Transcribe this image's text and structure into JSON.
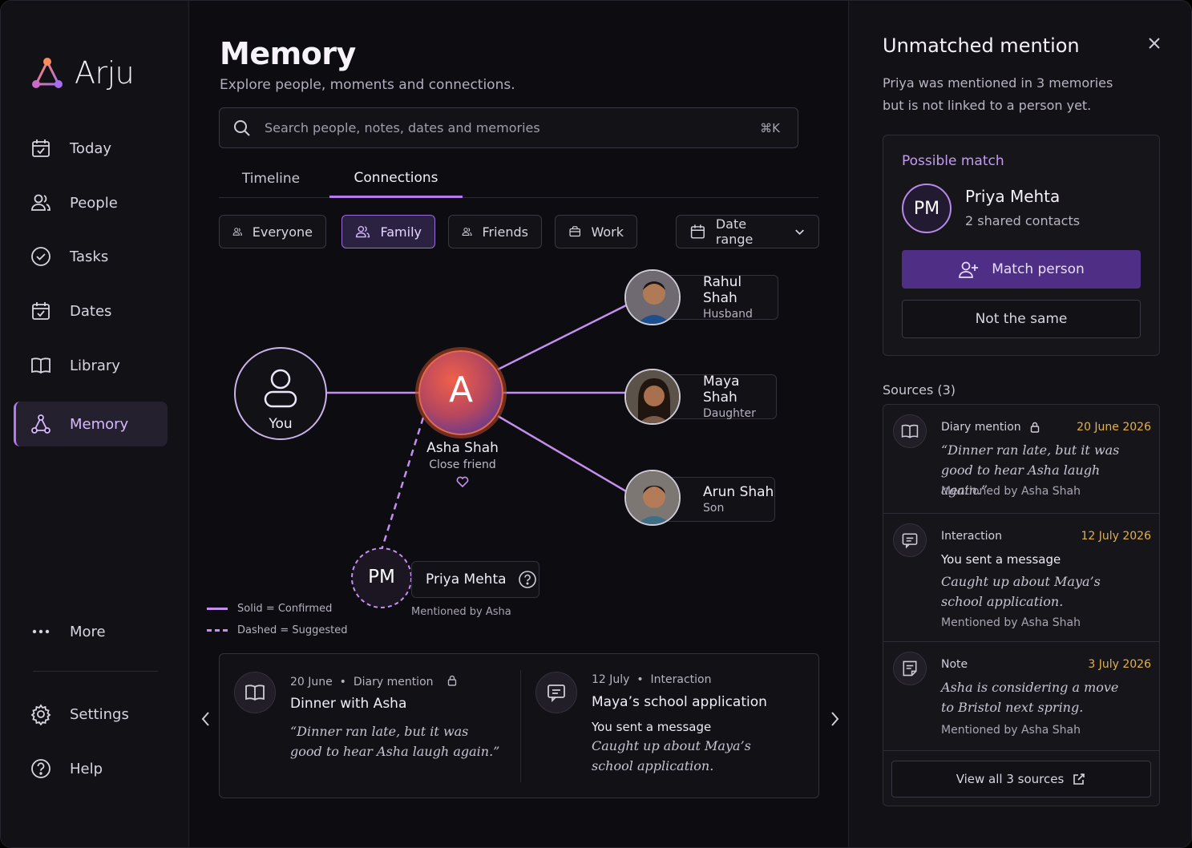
{
  "brand": {
    "name": "Arju"
  },
  "nav": {
    "today": "Today",
    "people": "People",
    "tasks": "Tasks",
    "dates": "Dates",
    "library": "Library",
    "memory": "Memory",
    "more": "More",
    "settings": "Settings",
    "help": "Help"
  },
  "header": {
    "title": "Memory",
    "subtitle": "Explore people, moments and connections."
  },
  "search": {
    "placeholder": "Search people, notes, dates and memories",
    "shortcut": "⌘K"
  },
  "tabs": {
    "timeline": "Timeline",
    "connections": "Connections"
  },
  "filters": {
    "everyone": "Everyone",
    "family": "Family",
    "friends": "Friends",
    "work": "Work",
    "date_range": "Date range"
  },
  "graph": {
    "you": "You",
    "center": {
      "initial": "A",
      "name": "Asha Shah",
      "role": "Close friend"
    },
    "people": [
      {
        "name": "Rahul Shah",
        "role": "Husband"
      },
      {
        "name": "Maya Shah",
        "role": "Daughter"
      },
      {
        "name": "Arun Shah",
        "role": "Son"
      }
    ],
    "suggested": {
      "initials": "PM",
      "name": "Priya Mehta",
      "note": "Mentioned by Asha"
    },
    "legend": {
      "solid": "Solid = Confirmed",
      "dashed": "Dashed = Suggested"
    }
  },
  "cards": [
    {
      "date": "20 June",
      "type": "Diary mention",
      "title": "Dinner with Asha",
      "quote": "“Dinner ran late, but it was good to hear Asha laugh again.”"
    },
    {
      "date": "12 July",
      "type": "Interaction",
      "title": "Maya’s school application",
      "line": "You sent a message",
      "quote": "Caught up about Maya’s school application."
    }
  ],
  "panel": {
    "title": "Unmatched mention",
    "desc": "Priya was mentioned in 3 memories but is not linked to a person yet.",
    "match": {
      "heading": "Possible match",
      "initials": "PM",
      "name": "Priya Mehta",
      "meta": "2 shared contacts",
      "match_btn": "Match person",
      "not_btn": "Not the same"
    },
    "sources_heading": "Sources (3)",
    "sources": [
      {
        "kind": "Diary mention",
        "date": "20 June 2026",
        "quote": "“Dinner ran late, but it was good to hear Asha laugh again.”",
        "by": "Mentioned by Asha Shah"
      },
      {
        "kind": "Interaction",
        "date": "12 July 2026",
        "line": "You sent a message",
        "quote": "Caught up about Maya’s school application.",
        "by": "Mentioned by Asha Shah"
      },
      {
        "kind": "Note",
        "date": "3 July 2026",
        "quote": "Asha is considering a move to Bristol next spring.",
        "by": "Mentioned by Asha Shah"
      }
    ],
    "view_all": "View all 3 sources"
  },
  "colors": {
    "accent": "#b57af0",
    "accent_dark": "#4f2f86",
    "date_gold": "#e4b04a"
  }
}
